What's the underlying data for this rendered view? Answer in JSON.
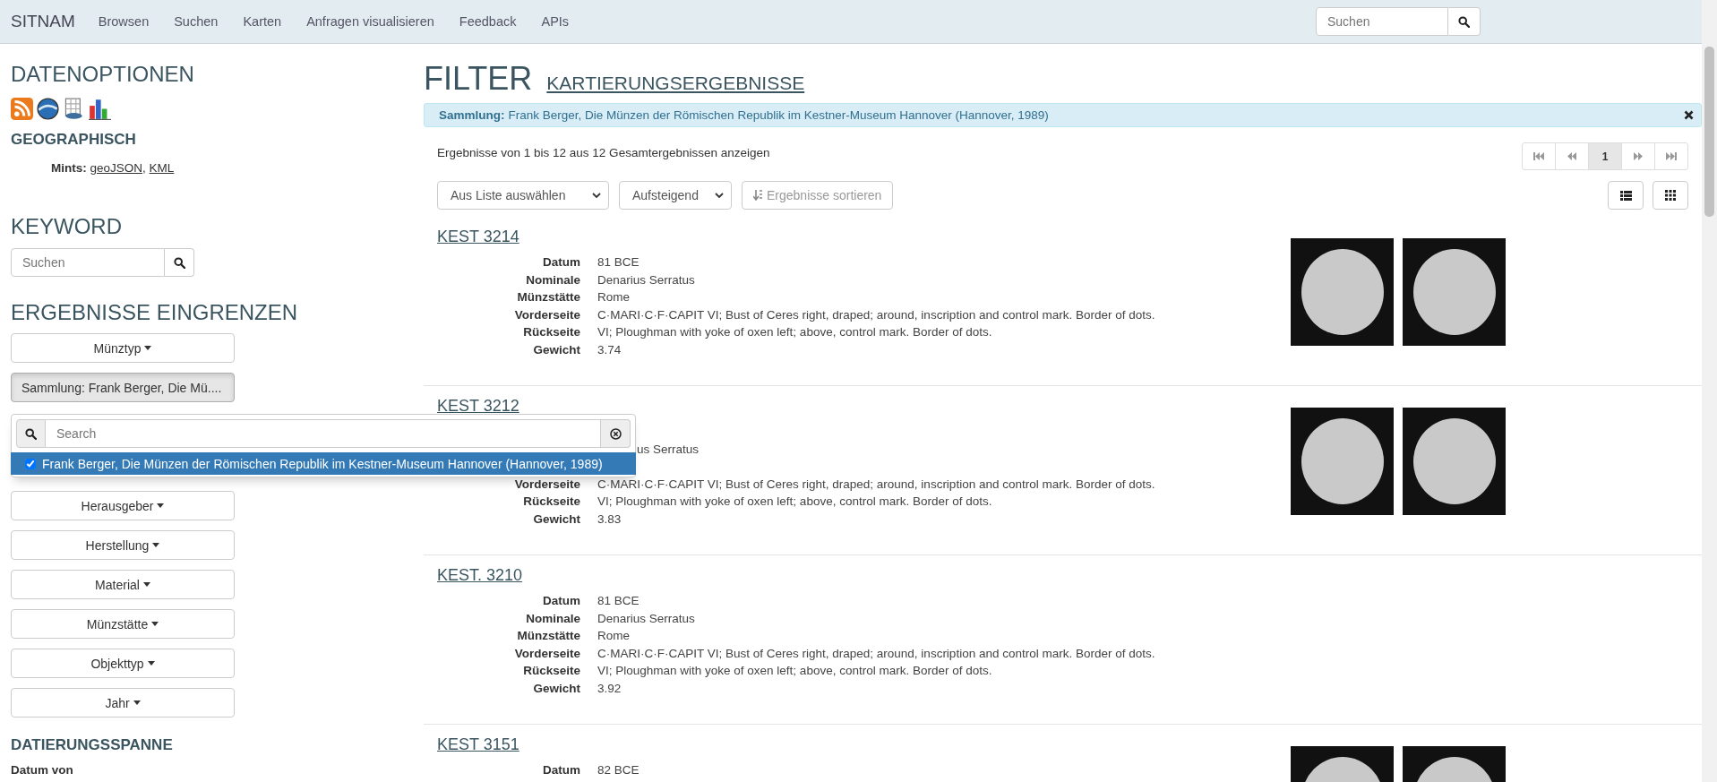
{
  "navbar": {
    "brand": "SITNAM",
    "links": [
      "Browsen",
      "Suchen",
      "Karten",
      "Anfragen visualisieren",
      "Feedback",
      "APIs"
    ],
    "search": {
      "placeholder": "Suchen"
    }
  },
  "sidebar": {
    "data_options": {
      "title": "DATENOPTIONEN",
      "geo_title": "GEOGRAPHISCH",
      "mints_label": "Mints:",
      "links": [
        "geoJSON",
        "KML"
      ],
      "separator": ","
    },
    "keyword": {
      "title": "KEYWORD",
      "search": {
        "placeholder": "Suchen"
      }
    },
    "refine": {
      "title": "ERGEBNISSE EINGRENZEN",
      "filters": [
        {
          "label": "Münztyp",
          "active": false
        },
        {
          "label": "Sammlung: Frank Berger, Die Mü....",
          "active": true,
          "dropdown": {
            "search": {
              "placeholder": "Search"
            },
            "options": [
              {
                "label": "Frank Berger, Die Münzen der Römischen Republik im Kestner-Museum Hannover (Hannover, 1989)",
                "checked": true,
                "selected": true
              }
            ]
          }
        },
        {
          "label": "Herausgeber",
          "active": false
        },
        {
          "label": "Herstellung",
          "active": false
        },
        {
          "label": "Material",
          "active": false
        },
        {
          "label": "Münzstätte",
          "active": false
        },
        {
          "label": "Objekttyp",
          "active": false
        },
        {
          "label": "Jahr",
          "active": false
        }
      ]
    },
    "date_range": {
      "title": "DATIERUNGSSPANNE",
      "from_label": "Datum von"
    }
  },
  "main": {
    "title": "FILTER",
    "map_link": "KARTIERUNGSERGEBNISSE",
    "active_filter": {
      "label": "Sammlung:",
      "value": "Frank Berger, Die Münzen der Römischen Republik im Kestner-Museum Hannover (Hannover, 1989)"
    },
    "summary": "Ergebnisse von 1 bis 12 aus 12 Gesamtergebnissen anzeigen",
    "pagination": {
      "pages": [
        {
          "label": "1",
          "selected": true
        }
      ]
    },
    "sort": {
      "field": "Aus Liste auswählen",
      "order": "Aufsteigend",
      "button": "Ergebnisse sortieren"
    },
    "view": [
      {
        "kind": "list",
        "selected": false
      },
      {
        "kind": "grid",
        "selected": false
      }
    ],
    "results": [
      {
        "title": "KEST 3214",
        "images": true,
        "fields": [
          {
            "label": "Datum",
            "value": "81 BCE"
          },
          {
            "label": "Nominale",
            "value": "Denarius Serratus"
          },
          {
            "label": "Münzstätte",
            "value": "Rome"
          },
          {
            "label": "Vorderseite",
            "value": "C·MARI·C·F·CAPIT VI; Bust of Ceres right, draped; around, inscription and control mark. Border of dots."
          },
          {
            "label": "Rückseite",
            "value": "VI; Ploughman with yoke of oxen left; above, control mark. Border of dots."
          },
          {
            "label": "Gewicht",
            "value": "3.74"
          }
        ]
      },
      {
        "title": "KEST 3212",
        "images": true,
        "fields": [
          {
            "kind": "partial",
            "value": "us Serratus"
          },
          {
            "label": "Vorderseite",
            "value": "C·MARI·C·F·CAPIT VI; Bust of Ceres right, draped; around, inscription and control mark. Border of dots."
          },
          {
            "label": "Rückseite",
            "value": "VI; Ploughman with yoke of oxen left; above, control mark. Border of dots."
          },
          {
            "label": "Gewicht",
            "value": "3.83"
          }
        ]
      },
      {
        "title": "KEST. 3210",
        "images": false,
        "fields": [
          {
            "label": "Datum",
            "value": "81 BCE"
          },
          {
            "label": "Nominale",
            "value": "Denarius Serratus"
          },
          {
            "label": "Münzstätte",
            "value": "Rome"
          },
          {
            "label": "Vorderseite",
            "value": "C·MARI·C·F·CAPIT VI; Bust of Ceres right, draped; around, inscription and control mark. Border of dots."
          },
          {
            "label": "Rückseite",
            "value": "VI; Ploughman with yoke of oxen left; above, control mark. Border of dots."
          },
          {
            "label": "Gewicht",
            "value": "3.92"
          }
        ]
      },
      {
        "title": "KEST 3151",
        "images": true,
        "fields": [
          {
            "label": "Datum",
            "value": "82 BCE"
          }
        ]
      }
    ]
  }
}
